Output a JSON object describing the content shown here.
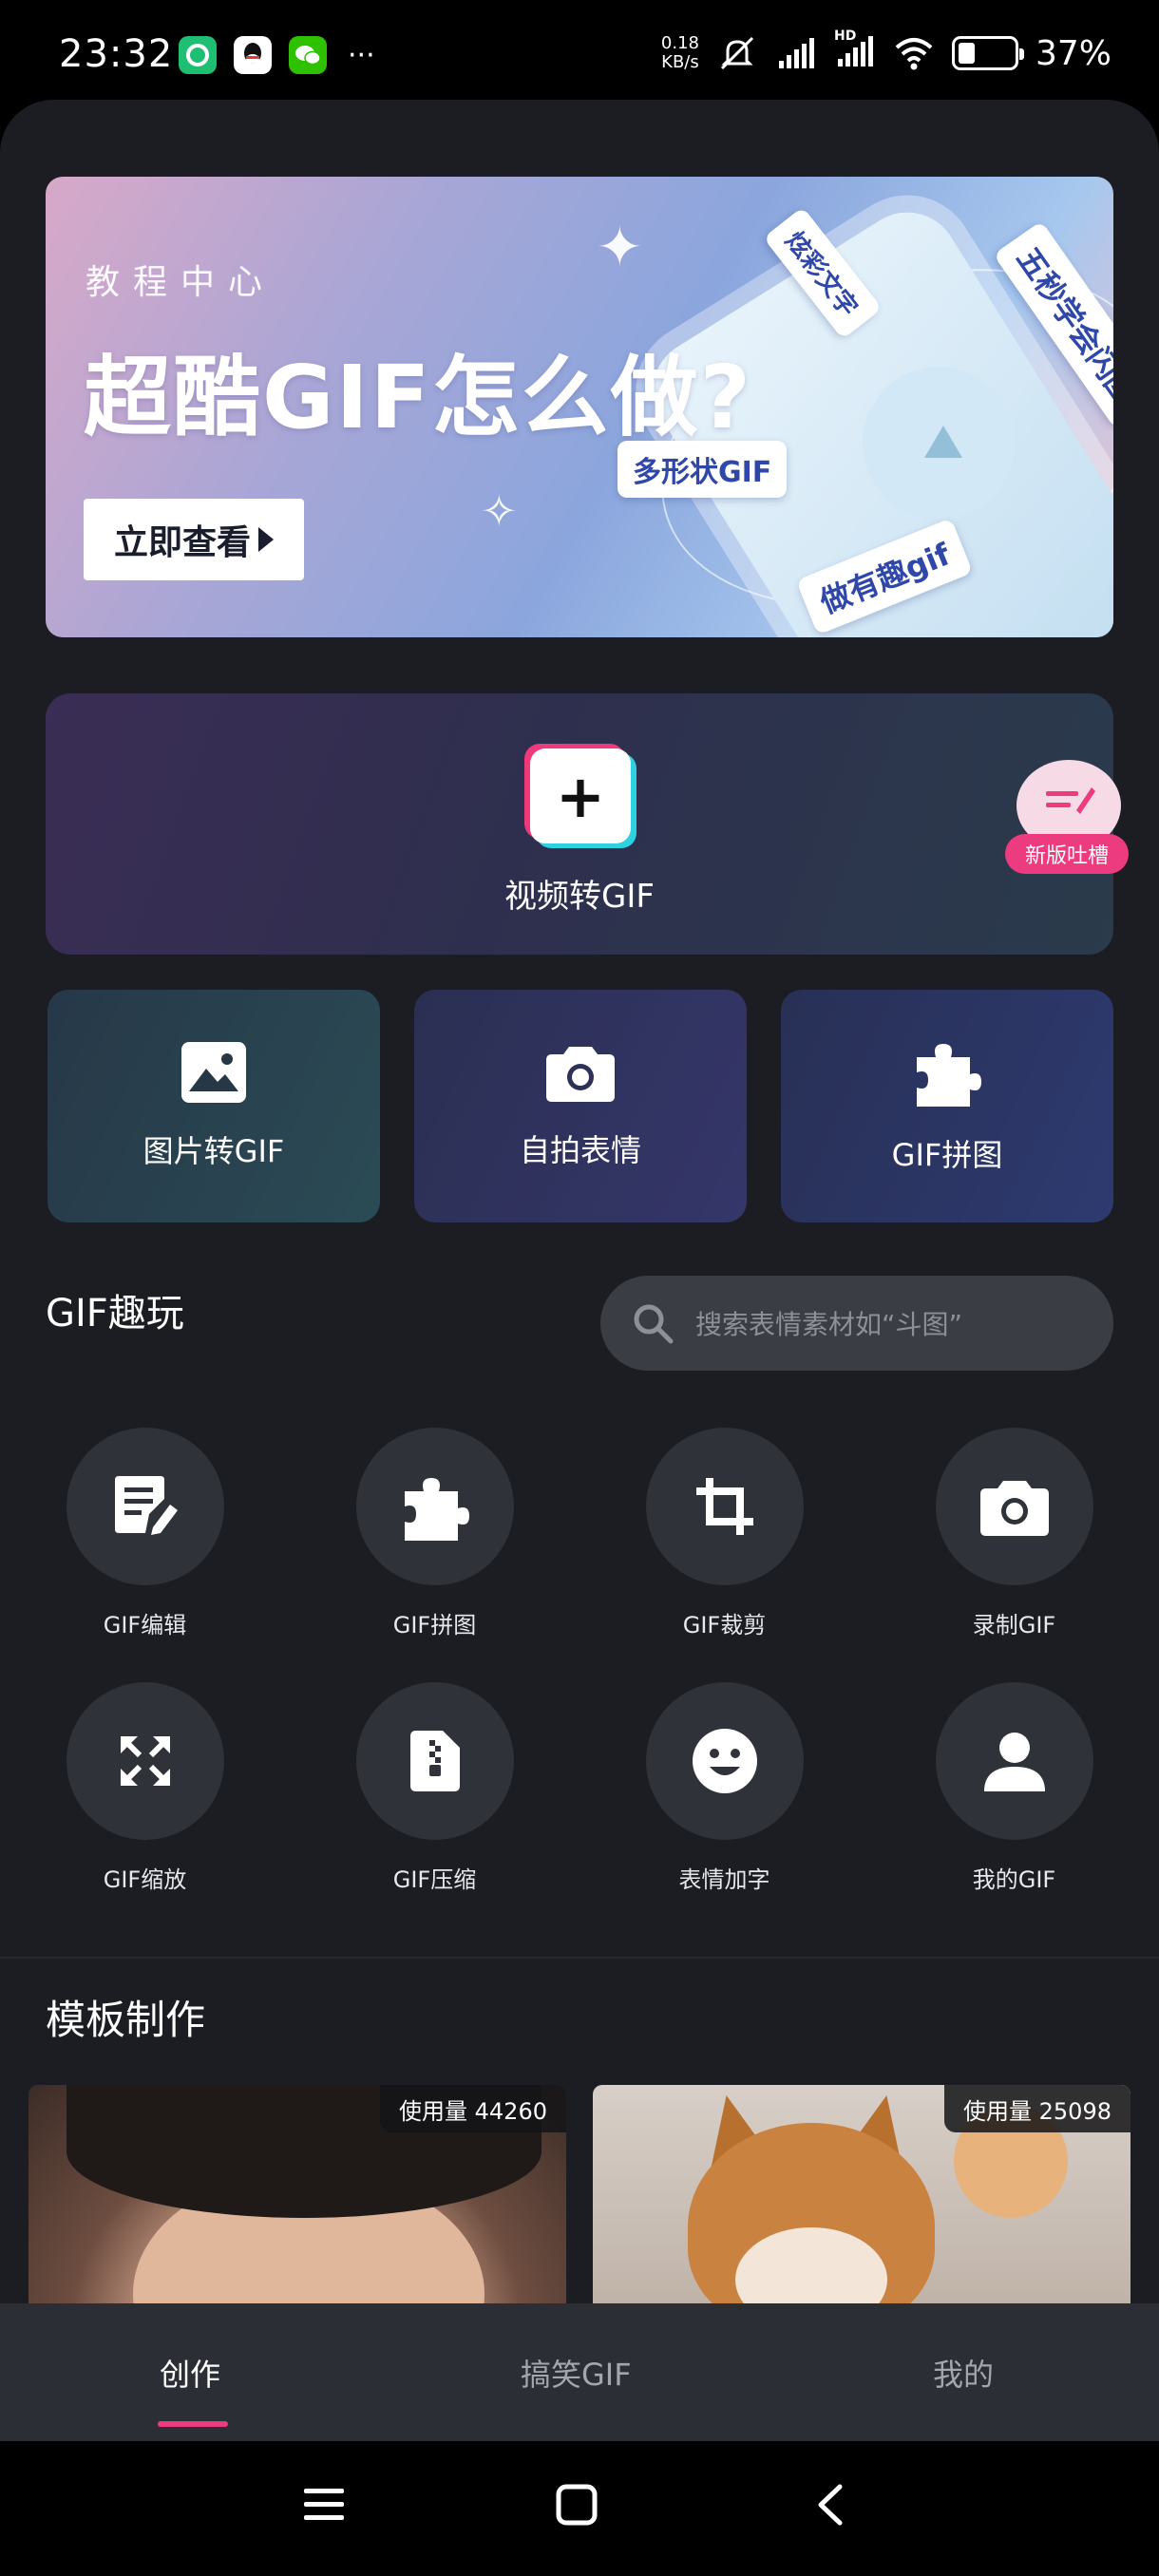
{
  "status_bar": {
    "time": "23:32",
    "speed_value": "0.18",
    "speed_unit": "KB/s",
    "battery_percent": "37%",
    "battery_level": 0.37,
    "more": "···",
    "network_label": "HD",
    "icons": [
      "app-360-icon",
      "qq-icon",
      "wechat-icon",
      "mute-icon",
      "signal-icon",
      "signal-icon-2",
      "wifi-icon",
      "battery-icon"
    ]
  },
  "banner": {
    "subtitle": "教程中心",
    "title": "超酷GIF怎么做?",
    "button": "立即查看",
    "stickers": [
      "炫彩文字",
      "五秒学会闪图",
      "多形状GIF",
      "做有趣gif"
    ]
  },
  "main_card": {
    "label": "视频转GIF",
    "feedback_label": "新版吐槽"
  },
  "tiles": [
    {
      "label": "图片转GIF",
      "icon": "image-icon"
    },
    {
      "label": "自拍表情",
      "icon": "camera-icon"
    },
    {
      "label": "GIF拼图",
      "icon": "puzzle-icon"
    }
  ],
  "fun": {
    "title": "GIF趣玩",
    "search_placeholder": "搜索表情素材如“斗图”"
  },
  "tools": [
    {
      "label": "GIF编辑",
      "icon": "edit-icon"
    },
    {
      "label": "GIF拼图",
      "icon": "puzzle-icon"
    },
    {
      "label": "GIF裁剪",
      "icon": "crop-icon"
    },
    {
      "label": "录制GIF",
      "icon": "camera-icon"
    },
    {
      "label": "GIF缩放",
      "icon": "resize-icon"
    },
    {
      "label": "GIF压缩",
      "icon": "zip-file-icon"
    },
    {
      "label": "表情加字",
      "icon": "smile-icon"
    },
    {
      "label": "我的GIF",
      "icon": "user-icon"
    }
  ],
  "templates": {
    "title": "模板制作",
    "items": [
      {
        "usage": "使用量 44260"
      },
      {
        "usage": "使用量 25098"
      }
    ]
  },
  "tabbar": {
    "tabs": [
      {
        "label": "创作",
        "active": true
      },
      {
        "label": "搞笑GIF",
        "active": false
      },
      {
        "label": "我的",
        "active": false
      }
    ],
    "accent": "#ec3b7e"
  },
  "colors": {
    "background": "#1b1d22",
    "accent_pink": "#ec3b7e",
    "accent_cyan": "#2fd0df"
  }
}
